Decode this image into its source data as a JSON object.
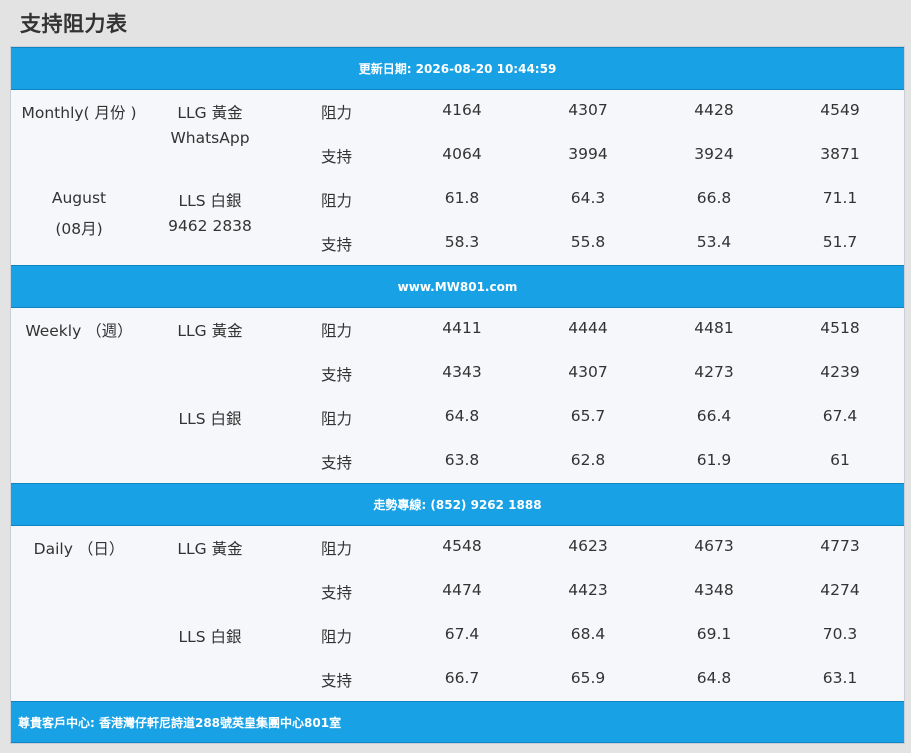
{
  "page": {
    "title": "支持阻力表"
  },
  "header_band": "更新日期: 2026-08-20 10:44:59",
  "band_website": "www.MW801.com",
  "band_hotline": "走勢專線: (852) 9262 1888",
  "footer_band": "尊貴客戶中心: 香港灣仔軒尼詩道288號英皇集團中心801室",
  "monthly": {
    "period_line1": "Monthly( 月份 )",
    "month_line1": "August",
    "month_line2": "(08月)",
    "gold": {
      "name": "LLG 黃金",
      "contact": "WhatsApp",
      "resistance_label": "阻力",
      "resistance": [
        "4164",
        "4307",
        "4428",
        "4549"
      ],
      "support_label": "支持",
      "support": [
        "4064",
        "3994",
        "3924",
        "3871"
      ]
    },
    "silver": {
      "name": "LLS 白銀",
      "contact": "9462 2838",
      "resistance_label": "阻力",
      "resistance": [
        "61.8",
        "64.3",
        "66.8",
        "71.1"
      ],
      "support_label": "支持",
      "support": [
        "58.3",
        "55.8",
        "53.4",
        "51.7"
      ]
    }
  },
  "weekly": {
    "period": "Weekly （週）",
    "gold": {
      "name": "LLG 黃金",
      "resistance_label": "阻力",
      "resistance": [
        "4411",
        "4444",
        "4481",
        "4518"
      ],
      "support_label": "支持",
      "support": [
        "4343",
        "4307",
        "4273",
        "4239"
      ]
    },
    "silver": {
      "name": "LLS 白銀",
      "resistance_label": "阻力",
      "resistance": [
        "64.8",
        "65.7",
        "66.4",
        "67.4"
      ],
      "support_label": "支持",
      "support": [
        "63.8",
        "62.8",
        "61.9",
        "61"
      ]
    }
  },
  "daily": {
    "period": "Daily （日）",
    "gold": {
      "name": "LLG 黃金",
      "resistance_label": "阻力",
      "resistance": [
        "4548",
        "4623",
        "4673",
        "4773"
      ],
      "support_label": "支持",
      "support": [
        "4474",
        "4423",
        "4348",
        "4274"
      ]
    },
    "silver": {
      "name": "LLS 白銀",
      "resistance_label": "阻力",
      "resistance": [
        "67.4",
        "68.4",
        "69.1",
        "70.3"
      ],
      "support_label": "支持",
      "support": [
        "66.7",
        "65.9",
        "64.8",
        "63.1"
      ]
    }
  },
  "colors": {
    "band": "#18a1e5",
    "panel": "#f6f7fa",
    "background": "#e3e3e3"
  }
}
